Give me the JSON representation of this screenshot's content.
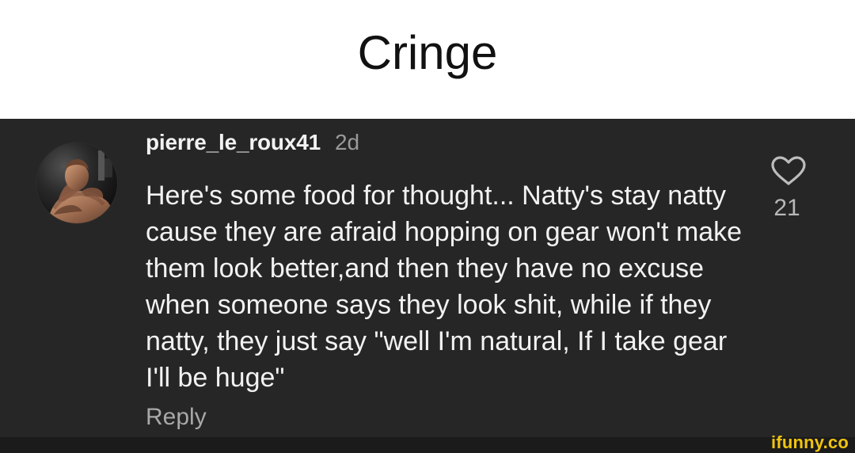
{
  "caption": {
    "title": "Cringe"
  },
  "comment": {
    "username": "pierre_le_roux41",
    "timestamp": "2d",
    "text": "Here's some food for thought... Natty's stay natty cause they are afraid hopping on gear won't make them look better,and then they have no excuse when someone says they look shit, while if they natty, they just say \"well I'm natural, If I take gear I'll be huge\"",
    "reply_label": "Reply",
    "like_count": "21",
    "avatar_icon": "profile-photo-avatar",
    "like_icon": "heart-outline-icon"
  },
  "watermark": {
    "text": "ifunny.co"
  },
  "colors": {
    "panel_background": "#262626",
    "text_primary": "#f2f2f2",
    "text_secondary": "#9a9a9a",
    "watermark": "#f1c40f"
  }
}
